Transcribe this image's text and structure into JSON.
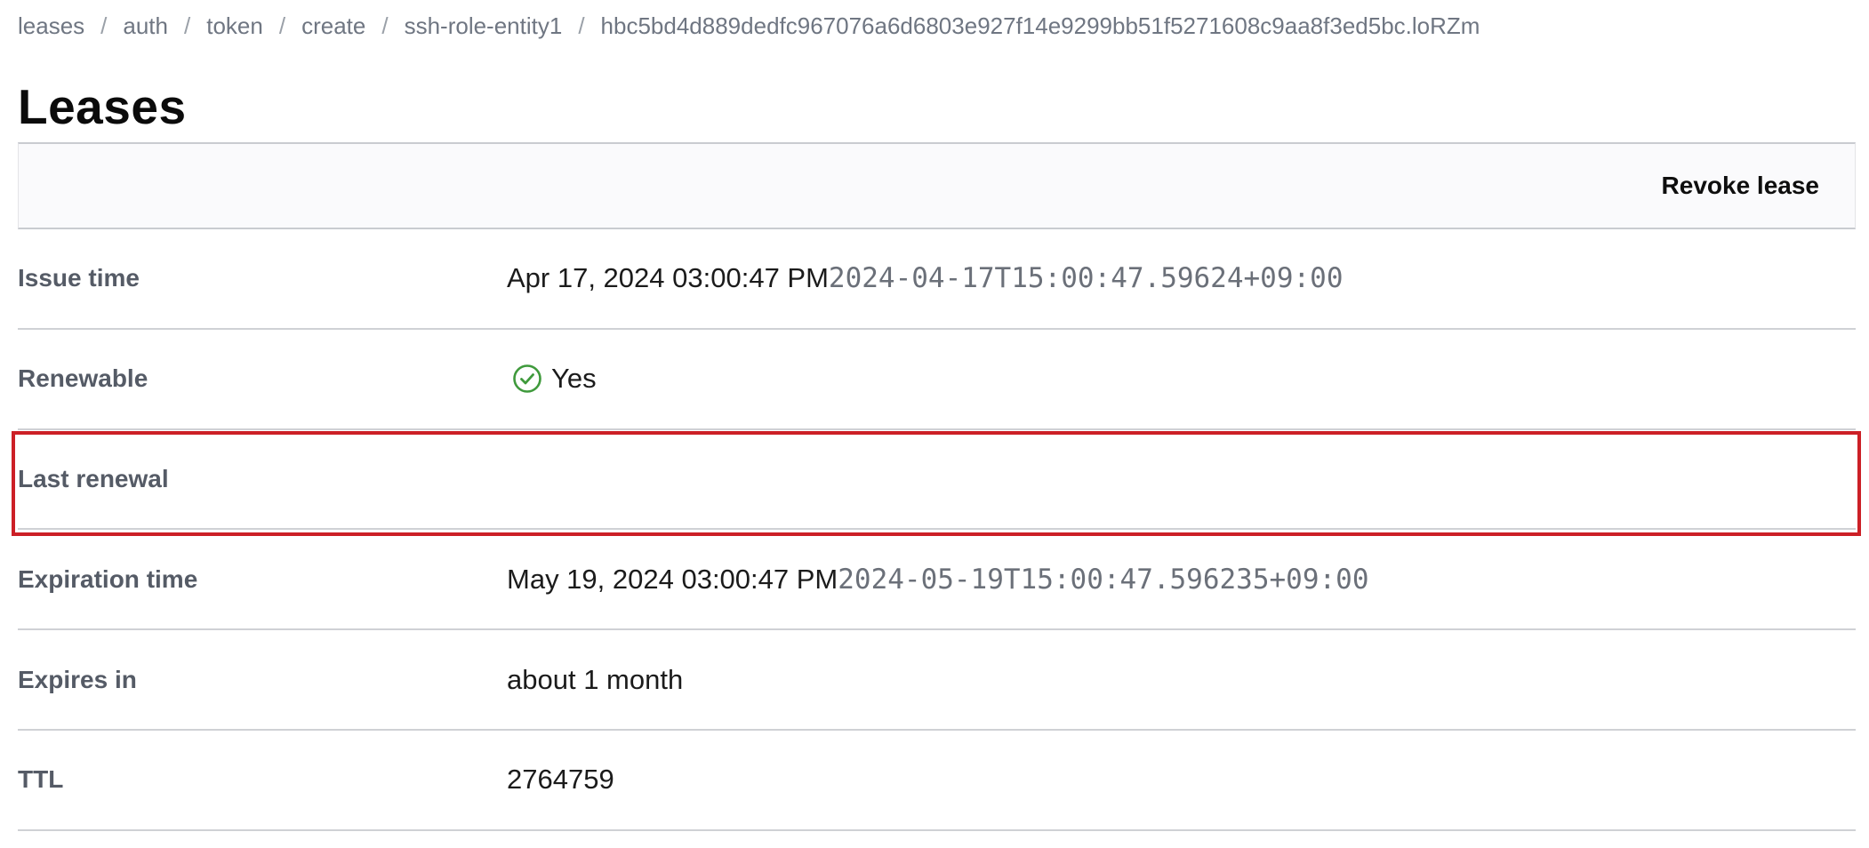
{
  "breadcrumb": [
    {
      "label": "leases"
    },
    {
      "label": "auth"
    },
    {
      "label": "token"
    },
    {
      "label": "create"
    },
    {
      "label": "ssh-role-entity1"
    },
    {
      "label": "hbc5bd4d889dedfc967076a6d6803e927f14e9299bb51f5271608c9aa8f3ed5bc.loRZm"
    }
  ],
  "breadcrumb_separator": "/",
  "page": {
    "title": "Leases"
  },
  "toolbar": {
    "revoke_label": "Revoke lease"
  },
  "details": {
    "issue_time": {
      "label": "Issue time",
      "display": "Apr 17, 2024 03:00:47 PM",
      "iso": "2024-04-17T15:00:47.59624+09:00"
    },
    "renewable": {
      "label": "Renewable",
      "value": "Yes",
      "icon": "check-circle-icon",
      "icon_color": "#3f9a3c"
    },
    "last_renewal": {
      "label": "Last renewal",
      "value": ""
    },
    "expiration_time": {
      "label": "Expiration time",
      "display": "May 19, 2024 03:00:47 PM",
      "iso": "2024-05-19T15:00:47.596235+09:00"
    },
    "expires_in": {
      "label": "Expires in",
      "value": "about 1 month"
    },
    "ttl": {
      "label": "TTL",
      "value": "2764759"
    }
  },
  "colors": {
    "highlight": "#cc1f26",
    "label": "#555b66",
    "breadcrumb": "#6f7682"
  }
}
